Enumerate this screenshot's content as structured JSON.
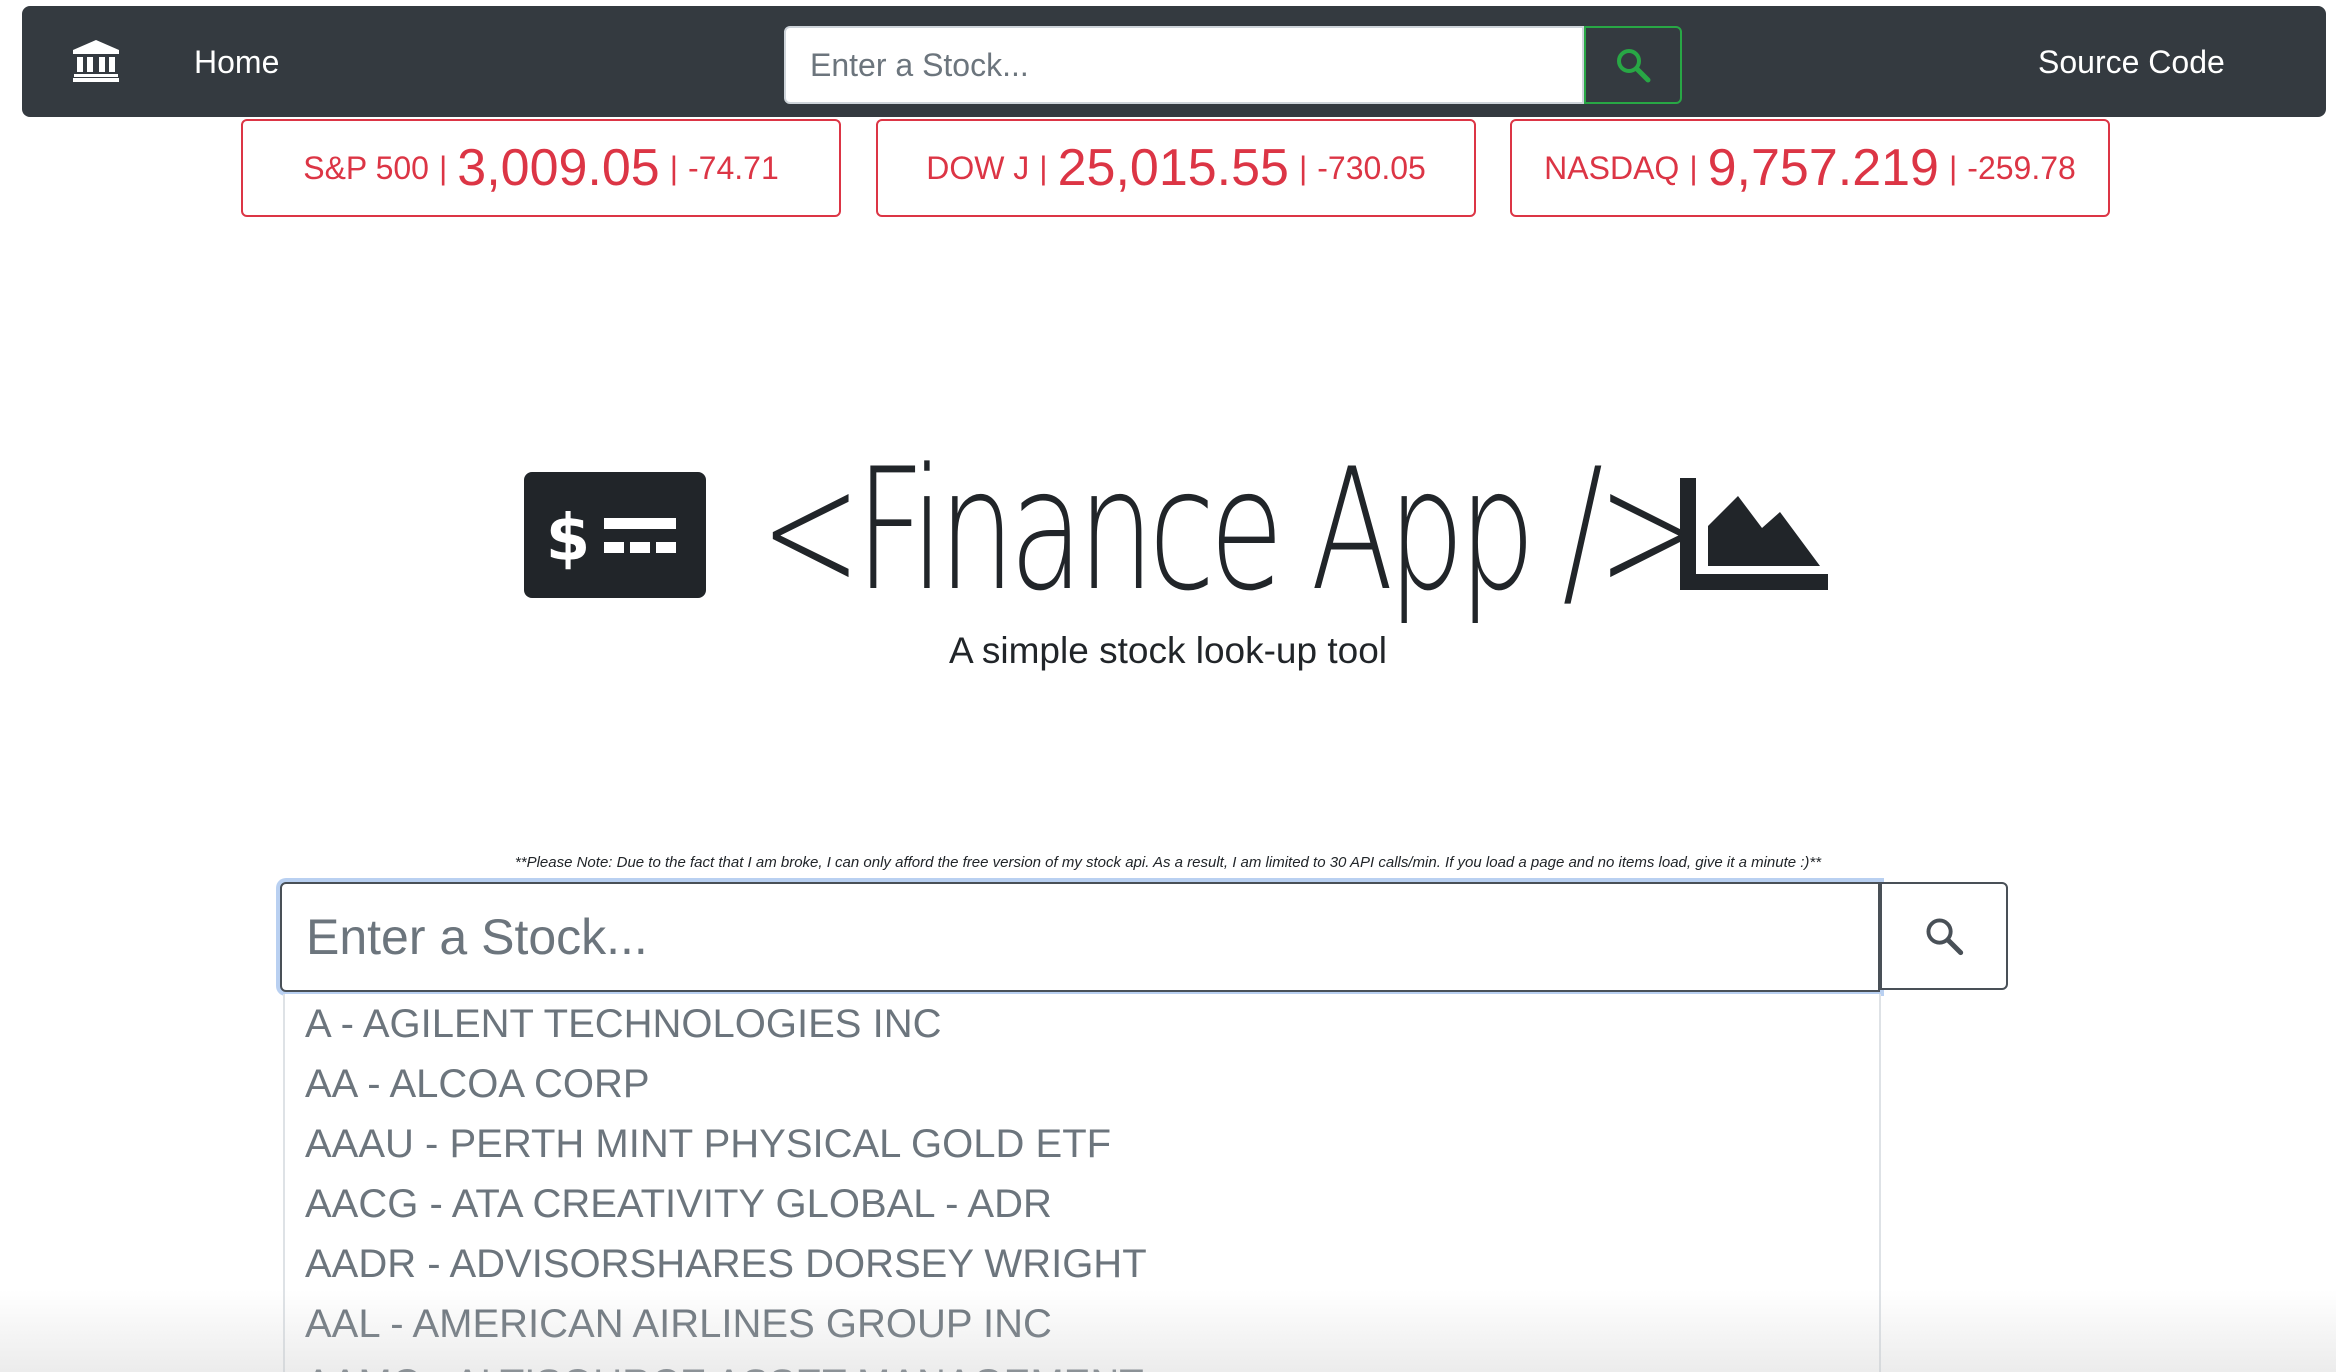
{
  "nav": {
    "home_label": "Home",
    "search_placeholder": "Enter a Stock...",
    "source_label": "Source Code",
    "brand_icon": "bank-icon",
    "search_icon": "search-icon"
  },
  "indices": [
    {
      "name": "S&P 500",
      "price": "3,009.05",
      "change": "-74.71"
    },
    {
      "name": "DOW J",
      "price": "25,015.55",
      "change": "-730.05"
    },
    {
      "name": "NASDAQ",
      "price": "9,757.219",
      "change": "-259.78"
    }
  ],
  "hero": {
    "title": "<Finance App />",
    "subtitle": "A simple stock look-up tool",
    "left_icon": "money-check-icon",
    "right_icon": "area-chart-icon"
  },
  "note": "**Please Note: Due to the fact that I am broke, I can only afford the free version of my stock api. As a result, I am limited to 30 API calls/min. If you load a page and no items load, give it a minute :)**",
  "search": {
    "placeholder": "Enter a Stock..."
  },
  "suggestions": [
    "A - AGILENT TECHNOLOGIES INC",
    "AA - ALCOA CORP",
    "AAAU - PERTH MINT PHYSICAL GOLD ETF",
    "AACG - ATA CREATIVITY GLOBAL - ADR",
    "AADR - ADVISORSHARES DORSEY WRIGHT",
    "AAL - AMERICAN AIRLINES GROUP INC",
    "AAMC - ALTISOURCE ASSET MANAGEMENT"
  ],
  "colors": {
    "navbar_bg": "#343a40",
    "negative": "#dc3545",
    "search_button_border": "#28a745",
    "text": "#212529"
  }
}
